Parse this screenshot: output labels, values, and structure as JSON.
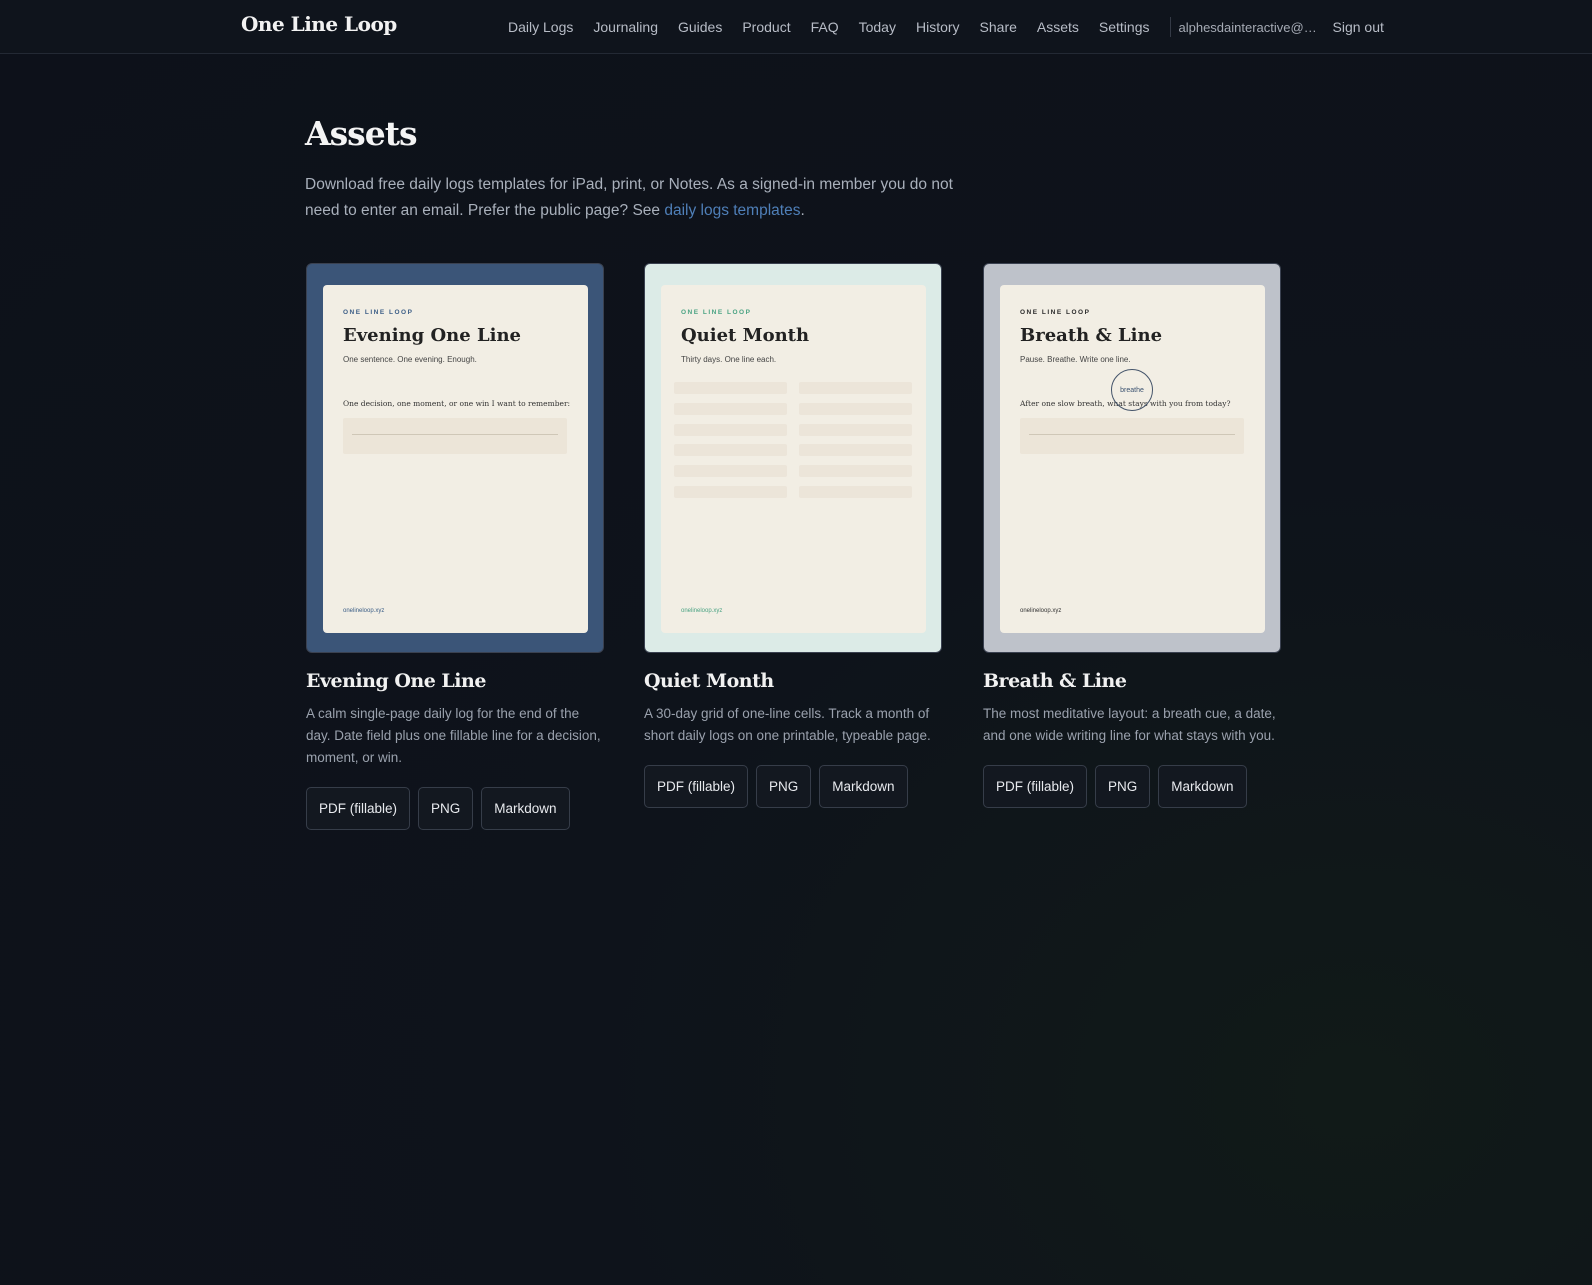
{
  "brand": "One Line Loop",
  "nav": {
    "items": [
      "Daily Logs",
      "Journaling",
      "Guides",
      "Product",
      "FAQ",
      "Today",
      "History",
      "Share",
      "Assets",
      "Settings"
    ],
    "email": "alphesdainteractive@gm...",
    "signout": "Sign out"
  },
  "page": {
    "title": "Assets",
    "intro_prefix": "Download free daily logs templates for iPad, print, or Notes. As a signed-in member you do not need to enter an email. Prefer the public page? See ",
    "intro_link": "daily logs templates",
    "intro_suffix": "."
  },
  "cards": [
    {
      "kicker": "ONE LINE LOOP",
      "sheet_title": "Evening One Line",
      "sheet_subtitle": "One sentence. One evening. Enough.",
      "prompt": "One decision, one moment, or one win I want to remember:",
      "footer": "onelineloop.xyz",
      "title": "Evening One Line",
      "description": "A calm single-page daily log for the end of the day. Date field plus one fillable line for a decision, moment, or win.",
      "buttons": [
        "PDF (fillable)",
        "PNG",
        "Markdown"
      ]
    },
    {
      "kicker": "ONE LINE LOOP",
      "sheet_title": "Quiet Month",
      "sheet_subtitle": "Thirty days. One line each.",
      "footer": "onelineloop.xyz",
      "title": "Quiet Month",
      "description": "A 30-day grid of one-line cells. Track a month of short daily logs on one printable, typeable page.",
      "buttons": [
        "PDF (fillable)",
        "PNG",
        "Markdown"
      ]
    },
    {
      "kicker": "ONE LINE LOOP",
      "sheet_title": "Breath & Line",
      "sheet_subtitle": "Pause. Breathe. Write one line.",
      "breath_label": "breathe",
      "prompt": "After one slow breath, what stays with you from today?",
      "footer": "onelineloop.xyz",
      "title": "Breath & Line",
      "description": "The most meditative layout: a breath cue, a date, and one wide writing line for what stays with you.",
      "buttons": [
        "PDF (fillable)",
        "PNG",
        "Markdown"
      ]
    }
  ],
  "colors": {
    "background": "#0d111a",
    "link": "#4f7fb8",
    "card1_frame": "#3b5578",
    "card2_frame": "#dcebe7",
    "card3_frame": "#bec2ca",
    "sheet": "#f2eee4"
  }
}
